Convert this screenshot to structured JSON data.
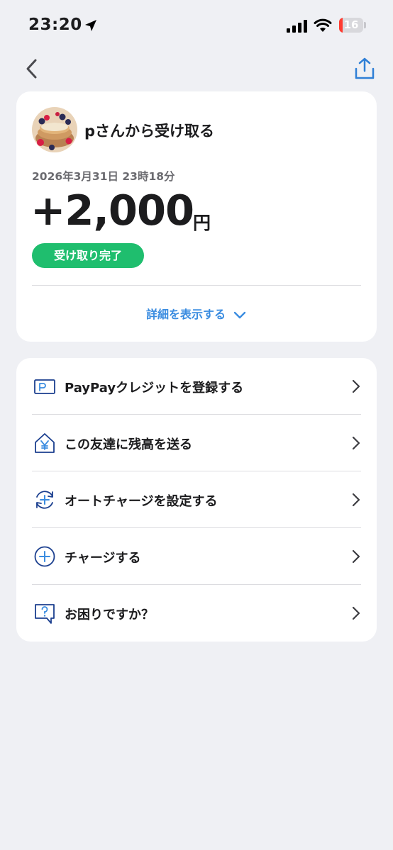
{
  "status": {
    "time": "23:20",
    "battery": "16"
  },
  "transaction": {
    "sender": "pさんから受け取る",
    "datetime": "2026年3月31日 23時18分",
    "amount": "+2,000",
    "currency": "円",
    "status_badge": "受け取り完了",
    "details_link": "詳細を表示する",
    "battery_level": 0.16
  },
  "menu": [
    {
      "label": "PayPayクレジットを登録する",
      "icon": "credit-card-icon"
    },
    {
      "label": "この友達に残高を送る",
      "icon": "house-yen-icon"
    },
    {
      "label": "オートチャージを設定する",
      "icon": "auto-charge-icon"
    },
    {
      "label": "チャージする",
      "icon": "plus-circle-icon"
    },
    {
      "label": "お困りですか？",
      "icon": "help-bubble-icon"
    }
  ],
  "colors": {
    "accent": "#3a8ce0",
    "success": "#1fbe6e",
    "icon_navy": "#1b3f8f",
    "background": "#eff0f4"
  }
}
